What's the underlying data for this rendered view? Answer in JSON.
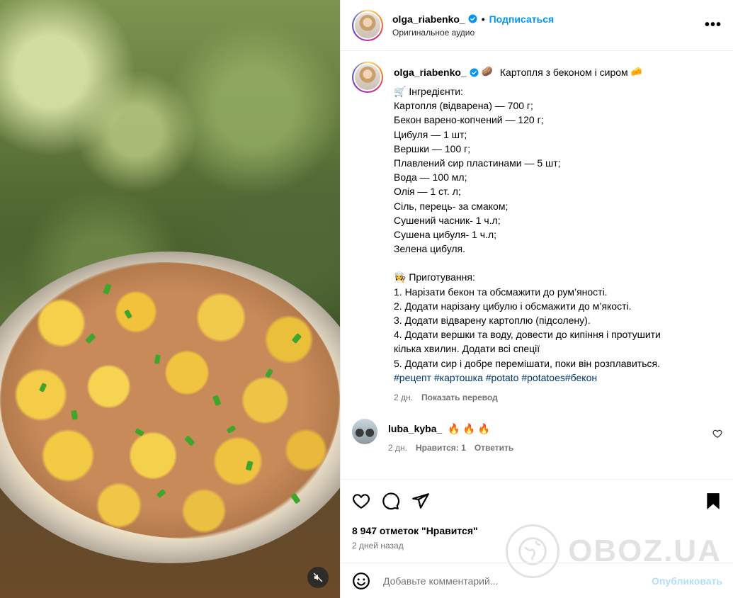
{
  "post": {
    "username": "olga_riabenko_",
    "follow_label": "Подписаться",
    "separator": "•",
    "audio_label": "Оригинальное аудио",
    "more_label": "•••"
  },
  "caption": {
    "username": "olga_riabenko_",
    "title": "Картопля з беконом і сиром",
    "lines": [
      "🛒 Інгрeдієнти:",
      "Картопля (відварена) — 700 г;",
      "Бекон варено-копчений — 120 г;",
      "Цибуля — 1 шт;",
      "Вершки — 100 г;",
      "Плавлений сир пластинами — 5 шт;",
      "Вода — 100 мл;",
      "Олія — 1 ст. л;",
      "Сіль, перець- за смаком;",
      "Сушений часник- 1 ч.л;",
      "Сушена цибуля- 1 ч.л;",
      "Зелена цибуля.",
      "",
      "👩‍🍳 Приготування:",
      "1. Нарізати бекон та обсмажити до рум’яності.",
      "2. Додати нарізану цибулю і обсмажити до м’якості.",
      "3. Додати відварену картоплю (підсолену).",
      "4. Додати вершки та воду, довести до кипіння і протушити",
      "кілька хвилин. Додати всі спеції",
      "5. Додати сир і добре перемішати, поки він розплавиться."
    ],
    "hashtags": "#рецепт #картошка #potato #potatoes#бекон",
    "time": "2 дн.",
    "translate_label": "Показать перевод"
  },
  "comment": {
    "username": "luba_kyba_",
    "text": "🔥 🔥 🔥",
    "time": "2 дн.",
    "likes_label": "Нравится: 1",
    "reply_label": "Ответить"
  },
  "stats": {
    "likes": "8 947 отметок \"Нравится\"",
    "date": "2 дней назад"
  },
  "composer": {
    "placeholder": "Добавьте комментарий...",
    "publish_label": "Опубликовать"
  },
  "watermark": {
    "text": "OBOZ.UA"
  },
  "colors": {
    "accent": "#0095f6",
    "link": "#00376b",
    "muted": "#737373",
    "publish_disabled": "#b2dffc"
  }
}
